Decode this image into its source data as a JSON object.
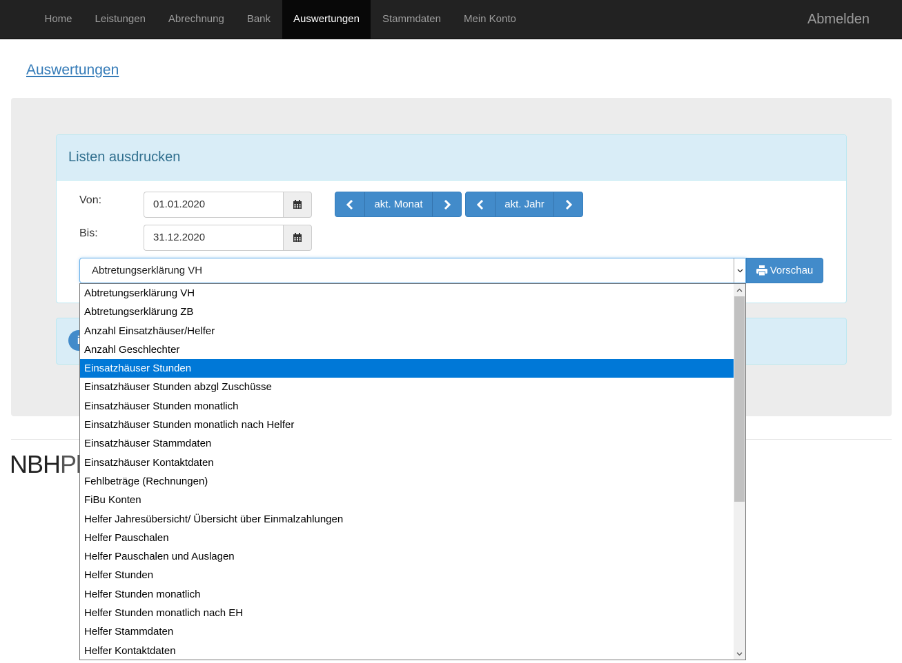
{
  "nav": {
    "items": [
      {
        "label": "Home",
        "active": false
      },
      {
        "label": "Leistungen",
        "active": false
      },
      {
        "label": "Abrechnung",
        "active": false
      },
      {
        "label": "Bank",
        "active": false
      },
      {
        "label": "Auswertungen",
        "active": true
      },
      {
        "label": "Stammdaten",
        "active": false
      },
      {
        "label": "Mein Konto",
        "active": false
      }
    ],
    "logout_label": "Abmelden"
  },
  "page": {
    "title": "Auswertungen"
  },
  "panel": {
    "title": "Listen ausdrucken",
    "from_label": "Von:",
    "from_value": "01.01.2020",
    "to_label": "Bis:",
    "to_value": "31.12.2020",
    "month_button": "akt. Monat",
    "year_button": "akt. Jahr",
    "report_select_value": "Abtretungserklärung VH",
    "preview_button": "Vorschau"
  },
  "info_alert": {
    "icon": "info-icon",
    "text": "i"
  },
  "footer": {
    "logo_bold": "NBH",
    "logo_light": "Pl"
  },
  "dropdown": {
    "selected_index": 4,
    "options": [
      "Abtretungserklärung VH",
      "Abtretungserklärung ZB",
      "Anzahl Einsatzhäuser/Helfer",
      "Anzahl Geschlechter",
      "Einsatzhäuser Stunden",
      "Einsatzhäuser Stunden abzgl Zuschüsse",
      "Einsatzhäuser Stunden monatlich",
      "Einsatzhäuser Stunden monatlich nach Helfer",
      "Einsatzhäuser Stammdaten",
      "Einsatzhäuser Kontaktdaten",
      "Fehlbeträge (Rechnungen)",
      "FiBu Konten",
      "Helfer Jahresübersicht/ Übersicht über Einmalzahlungen",
      "Helfer Pauschalen",
      "Helfer Pauschalen und Auslagen",
      "Helfer Stunden",
      "Helfer Stunden monatlich",
      "Helfer Stunden monatlich nach EH",
      "Helfer Stammdaten",
      "Helfer Kontaktdaten"
    ]
  },
  "colors": {
    "navbar": "#222222",
    "primary": "#428bca",
    "selection": "#0078d7",
    "panel_heading": "#d9edf7"
  }
}
